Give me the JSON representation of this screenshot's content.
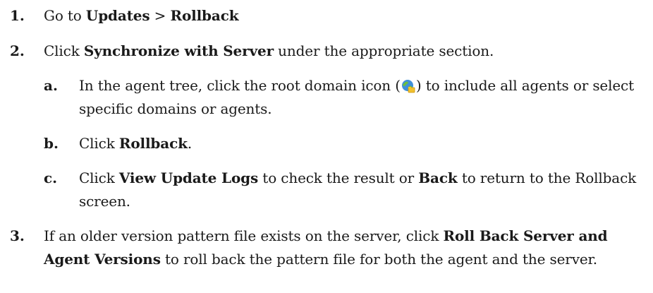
{
  "steps": [
    {
      "number": "1.",
      "pre": "Go to ",
      "bold1": "Updates",
      "mid": " > ",
      "bold2": "Rollback"
    },
    {
      "number": "2.",
      "pre": "Click ",
      "bold": "Synchronize with Server",
      "post": " under the appropriate section."
    },
    {
      "number": "3.",
      "pre": "If an older version pattern file exists on the server, click ",
      "bold": "Roll Back Server and Agent Versions",
      "post": " to roll back the pattern file for both the agent and the server."
    }
  ],
  "substeps": [
    {
      "letter": "a.",
      "pre": "In the agent tree, click the root domain icon (",
      "icon": "root-domain-icon",
      "post": ") to include all agents or select specific domains or agents."
    },
    {
      "letter": "b.",
      "pre": "Click ",
      "bold": "Rollback",
      "post": "."
    },
    {
      "letter": "c.",
      "pre": "Click ",
      "bold1": "View Update Logs",
      "mid": " to check the result or ",
      "bold2": "Back",
      "post": " to return to the Rollback screen."
    }
  ],
  "colors": {
    "text": "#1a1a1a",
    "globe": "#3f8fd8",
    "land": "#6cbf3c",
    "folder": "#f2c12e"
  }
}
